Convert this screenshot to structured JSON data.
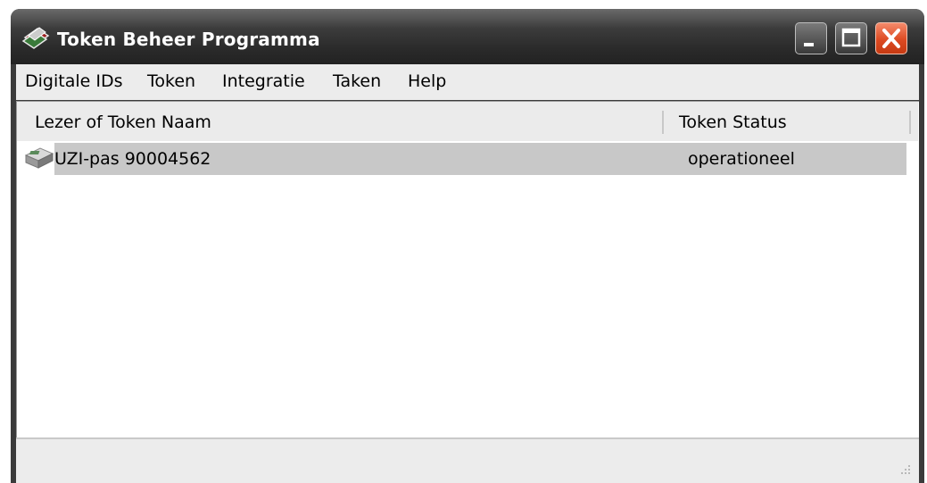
{
  "window": {
    "title": "Token Beheer Programma",
    "app_icon": "cards-icon",
    "controls": [
      "minimize-icon",
      "maximize-icon",
      "close-icon"
    ],
    "close_color": "#dd4a22"
  },
  "menu": {
    "items": [
      "Digitale IDs",
      "Token",
      "Integratie",
      "Taken",
      "Help"
    ]
  },
  "list": {
    "columns": [
      "Lezer of Token Naam",
      "Token Status"
    ],
    "rows": [
      {
        "icon": "card-reader-icon",
        "name": "UZI-pas 90004562",
        "status": "operationeel",
        "selected": true
      }
    ],
    "selection_color": "#c8c8c8"
  },
  "statusbar": {
    "text": ""
  }
}
